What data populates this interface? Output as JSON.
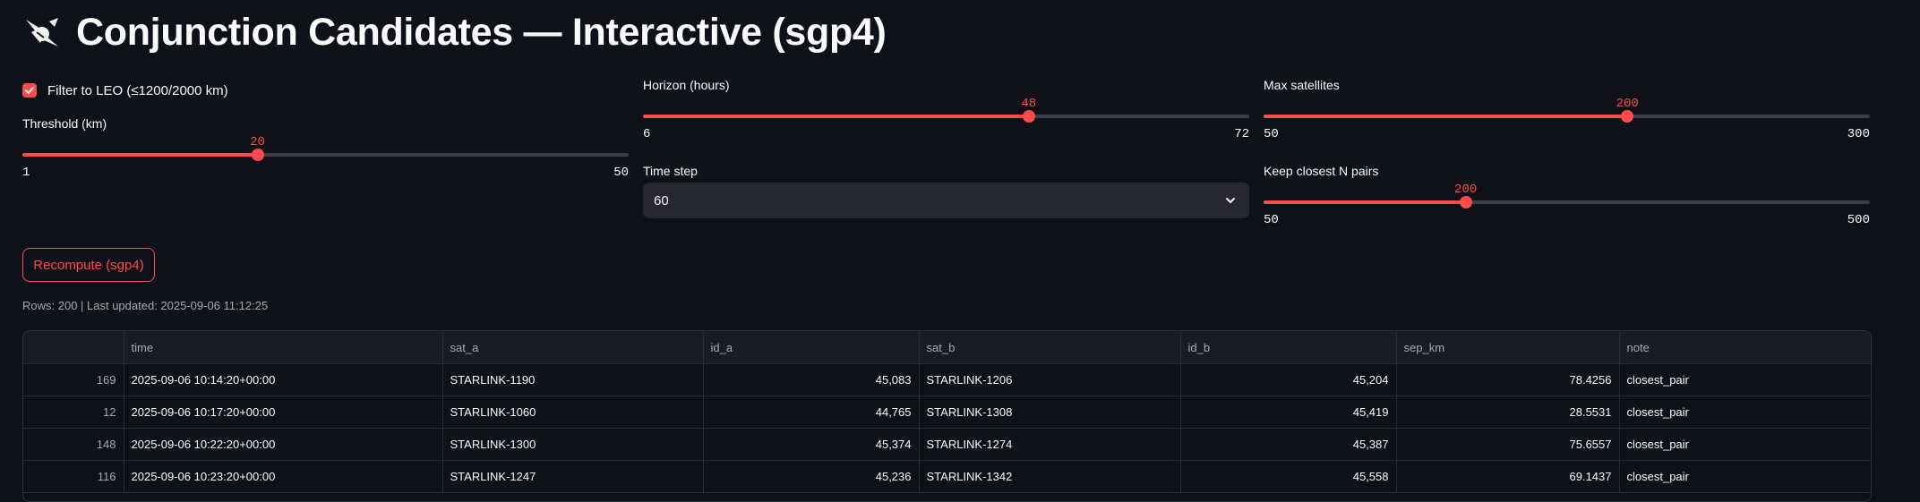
{
  "title": "Conjunction Candidates — Interactive (sgp4)",
  "title_icon": "comet-icon",
  "accent_color": "#ff4b4b",
  "leo_filter": {
    "label": "Filter to LEO (≤1200/2000 km)",
    "checked": true
  },
  "threshold": {
    "label": "Threshold (km)",
    "value": "20",
    "min": "1",
    "max": "50"
  },
  "horizon": {
    "label": "Horizon (hours)",
    "value": "48",
    "min": "6",
    "max": "72"
  },
  "time_step": {
    "label": "Time step",
    "value": "60"
  },
  "max_satellites": {
    "label": "Max satellites",
    "value": "200",
    "min": "50",
    "max": "300"
  },
  "keep_closest": {
    "label": "Keep closest N pairs",
    "value": "200",
    "min": "50",
    "max": "500"
  },
  "recompute": {
    "label": "Recompute (sgp4)"
  },
  "status": {
    "text": "Rows: 200 | Last updated: 2025-09-06 11:12:25"
  },
  "table": {
    "columns": [
      "",
      "time",
      "sat_a",
      "id_a",
      "sat_b",
      "id_b",
      "sep_km",
      "note"
    ],
    "rows": [
      [
        "169",
        "2025-09-06 10:14:20+00:00",
        "STARLINK-1190",
        "45,083",
        "STARLINK-1206",
        "45,204",
        "78.4256",
        "closest_pair"
      ],
      [
        "12",
        "2025-09-06 10:17:20+00:00",
        "STARLINK-1060",
        "44,765",
        "STARLINK-1308",
        "45,419",
        "28.5531",
        "closest_pair"
      ],
      [
        "148",
        "2025-09-06 10:22:20+00:00",
        "STARLINK-1300",
        "45,374",
        "STARLINK-1274",
        "45,387",
        "75.6557",
        "closest_pair"
      ],
      [
        "116",
        "2025-09-06 10:23:20+00:00",
        "STARLINK-1247",
        "45,236",
        "STARLINK-1342",
        "45,558",
        "69.1437",
        "closest_pair"
      ]
    ]
  }
}
